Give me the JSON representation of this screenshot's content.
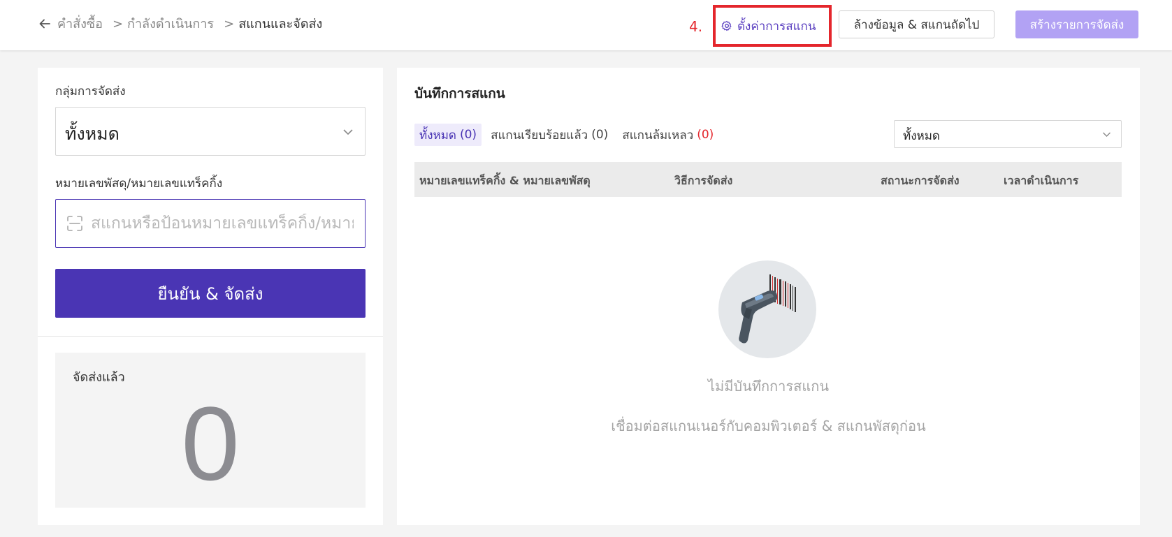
{
  "breadcrumb": {
    "items": [
      "คำสั่งซื้อ",
      "กำลังดำเนินการ",
      "สแกนและจัดส่ง"
    ],
    "separator": ">"
  },
  "toolbar": {
    "step_marker": "4.",
    "settings_label": "ตั้งค่าการสแกน",
    "clear_label": "ล้างข้อมูล & สแกนถัดไป",
    "create_label": "สร้างรายการจัดส่ง"
  },
  "left": {
    "group_label": "กลุ่มการจัดส่ง",
    "group_value": "ทั้งหมด",
    "tracking_label": "หมายเลขพัสดุ/หมายเลขแทร็คกิ้ง",
    "tracking_placeholder": "สแกนหรือป้อนหมายเลขแทร็คกิ้ง/หมายเลขพัสดุ",
    "confirm_label": "ยืนยัน & จัดส่ง",
    "shipped_title": "จัดส่งแล้ว",
    "shipped_count": "0"
  },
  "right": {
    "title": "บันทึกการสแกน",
    "tabs": [
      {
        "label": "ทั้งหมด",
        "count": "(0)"
      },
      {
        "label": "สแกนเรียบร้อยแล้ว",
        "count": "(0)"
      },
      {
        "label": "สแกนล้มเหลว",
        "count": "(0)"
      }
    ],
    "status_filter": "ทั้งหมด",
    "columns": [
      "หมายเลขแทร็คกิ้ง & หมายเลขพัสดุ",
      "วิธีการจัดส่ง",
      "สถานะการจัดส่ง",
      "เวลาดำเนินการ"
    ],
    "empty_title": "ไม่มีบันทึกการสแกน",
    "empty_subtitle": "เชื่อมต่อสแกนเนอร์กับคอมพิวเตอร์ & สแกนพัสดุก่อน"
  },
  "colors": {
    "primary": "#4a35b4",
    "primary_light": "#b2a2f4",
    "highlight": "#e4262c",
    "fail": "#e4262c"
  },
  "icons": [
    "arrow-left-icon",
    "gear-icon",
    "chevron-down-icon",
    "scan-frame-icon",
    "barcode-scanner-illustration"
  ]
}
